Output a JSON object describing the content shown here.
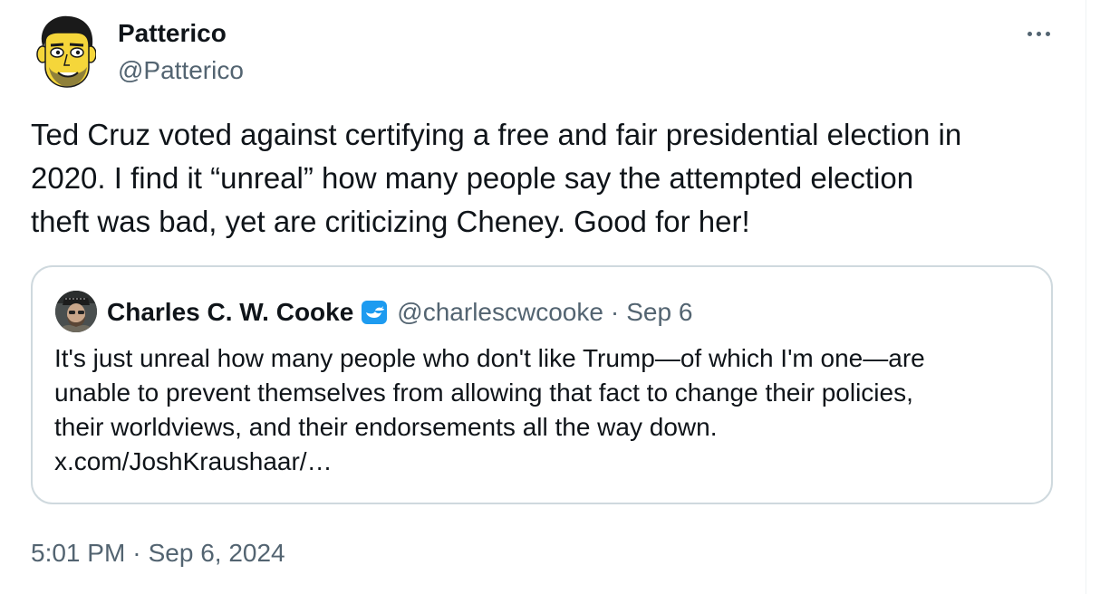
{
  "tweet": {
    "author": {
      "display_name": "Patterico",
      "handle": "@Patterico",
      "avatar_icon": "cartoon-avatar-icon"
    },
    "more_icon": "more-options-icon",
    "text": "Ted Cruz voted against certifying a free and fair presidential election in\n2020. I find it “unreal” how many people say the attempted election\ntheft was bad, yet are criticizing Cheney. Good for her!",
    "quote": {
      "author": {
        "display_name": "Charles C. W. Cooke",
        "handle": "@charlescwcooke",
        "verified_icon": "verified-badge-icon",
        "avatar_icon": "photo-avatar-icon"
      },
      "separator": "·",
      "date": "Sep 6",
      "text": "It's just unreal how many people who don't like Trump—of which I'm one—are\nunable to prevent themselves from allowing that fact to change their policies,\ntheir worldviews, and their endorsements all the way down.\nx.com/JoshKraushaar/…"
    },
    "time": "5:01 PM",
    "separator": "·",
    "date": "Sep 6, 2024"
  },
  "colors": {
    "text_primary": "#0f1419",
    "text_secondary": "#536471",
    "border": "#cfd9de",
    "verified_blue": "#1d9bf0",
    "avatar_yellow": "#f5d63a"
  }
}
